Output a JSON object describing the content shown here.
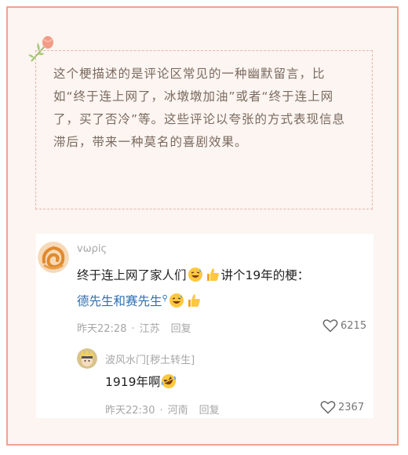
{
  "note": {
    "text": "这个梗描述的是评论区常见的一种幽默留言，比如“终于连上网了，冰墩墩加油”或者“终于连上网了，买了否冷”等。这些评论以夸张的方式表现信息滞后，带来一种莫名的喜剧效果。"
  },
  "comment": {
    "username": "vωρiς",
    "text_part1": "终于连上网了家人们",
    "text_part2": "讲个19年的梗：",
    "link_text": "德先生和赛先生",
    "time": "昨天22:28",
    "location": "江苏",
    "reply_label": "回复",
    "likes": "6215"
  },
  "reply": {
    "username": "波风水门[秽土转生]",
    "text": "1919年啊",
    "time": "昨天22:30",
    "location": "河南",
    "reply_label": "回复",
    "likes": "2367"
  },
  "icons": {
    "flower": "tulip-sprig-icon",
    "avatar_main": "orange-swirl-avatar",
    "avatar_sub": "anime-character-avatar",
    "emoji_laugh": "grinning-sweat-emoji",
    "emoji_thumb": "thumbs-up-emoji",
    "emoji_rofl": "rolling-laughing-emoji",
    "heart": "heart-outline-icon"
  },
  "colors": {
    "frame_border": "#f0a48e",
    "frame_bg": "#fcf5f1",
    "note_text": "#7a6a60",
    "link": "#2f6fb3"
  }
}
